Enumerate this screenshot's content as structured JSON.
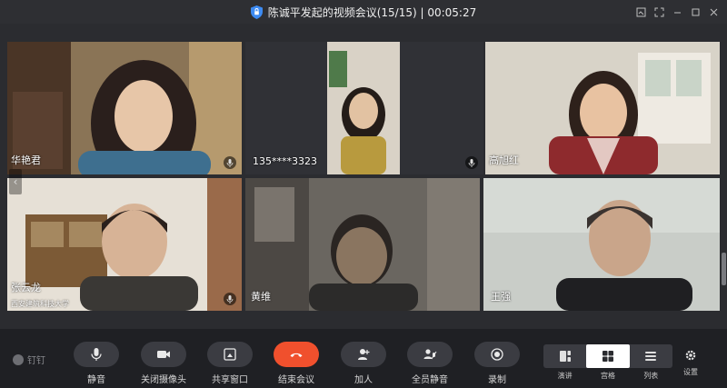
{
  "window": {
    "title": "陈诚平发起的视频会议(15/15) | 00:05:27",
    "controls": [
      "screenshot-icon",
      "fullscreen-icon",
      "minimize-icon",
      "maximize-icon",
      "close-icon"
    ]
  },
  "participants": [
    {
      "name": "华艳君",
      "subtitle": "",
      "mic": "mic-icon"
    },
    {
      "name": "135****3323",
      "subtitle": "",
      "mic": "mic-icon"
    },
    {
      "name": "高旭红",
      "subtitle": "",
      "mic": ""
    },
    {
      "name": "张云龙",
      "subtitle": "西安建筑科技大学",
      "mic": "mic-icon"
    },
    {
      "name": "黄维",
      "subtitle": "",
      "mic": ""
    },
    {
      "name": "王强",
      "subtitle": "",
      "mic": ""
    }
  ],
  "toolbar": {
    "app_name": "钉钉",
    "buttons": [
      {
        "label": "静音",
        "icon": "microphone-icon"
      },
      {
        "label": "关闭摄像头",
        "icon": "camera-icon"
      },
      {
        "label": "共享窗口",
        "icon": "share-screen-icon"
      },
      {
        "label": "结束会议",
        "icon": "hang-up-icon"
      },
      {
        "label": "加人",
        "icon": "add-person-icon"
      },
      {
        "label": "全员静音",
        "icon": "mute-all-icon"
      },
      {
        "label": "录制",
        "icon": "record-icon"
      }
    ],
    "layouts": [
      {
        "label": "演讲",
        "icon": "speaker-layout-icon",
        "active": false
      },
      {
        "label": "宫格",
        "icon": "grid-layout-icon",
        "active": true
      },
      {
        "label": "列表",
        "icon": "list-layout-icon",
        "active": false
      }
    ],
    "settings_label": "设置"
  },
  "colors": {
    "end_button": "#f0502d",
    "toolbar_bg": "#1f2024",
    "app_bg": "#2b2c30"
  }
}
